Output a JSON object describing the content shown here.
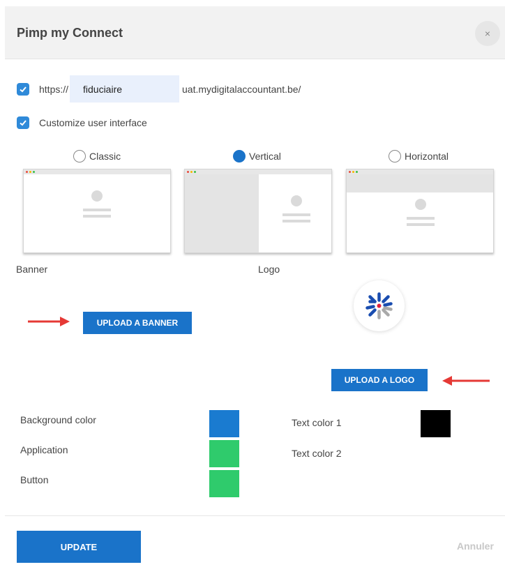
{
  "dialog": {
    "title": "Pimp my Connect",
    "close_icon": "×"
  },
  "url": {
    "prefix": "https://",
    "subdomain_value": "fiduciaire",
    "suffix": "uat.mydigitalaccountant.be/"
  },
  "customize": {
    "label": "Customize user interface",
    "checked": true
  },
  "layouts": [
    {
      "label": "Classic",
      "selected": false
    },
    {
      "label": "Vertical",
      "selected": true
    },
    {
      "label": "Horizontal",
      "selected": false
    }
  ],
  "banner": {
    "label": "Banner",
    "upload_label": "UPLOAD A BANNER"
  },
  "logo": {
    "label": "Logo",
    "upload_label": "UPLOAD A LOGO"
  },
  "colors": {
    "background": {
      "label": "Background color",
      "value": "#1a7bd0"
    },
    "application": {
      "label": "Application",
      "value": "#2fcb6c"
    },
    "button": {
      "label": "Button",
      "value": "#2fcb6c"
    },
    "text1": {
      "label": "Text color 1",
      "value": "#000000"
    },
    "text2": {
      "label": "Text color 2",
      "value": "#ffffff"
    }
  },
  "footer": {
    "update_label": "UPDATE",
    "cancel_label": "Annuler"
  },
  "theme": {
    "accent": "#1a73c9",
    "annotation_arrow": "#e53935"
  }
}
